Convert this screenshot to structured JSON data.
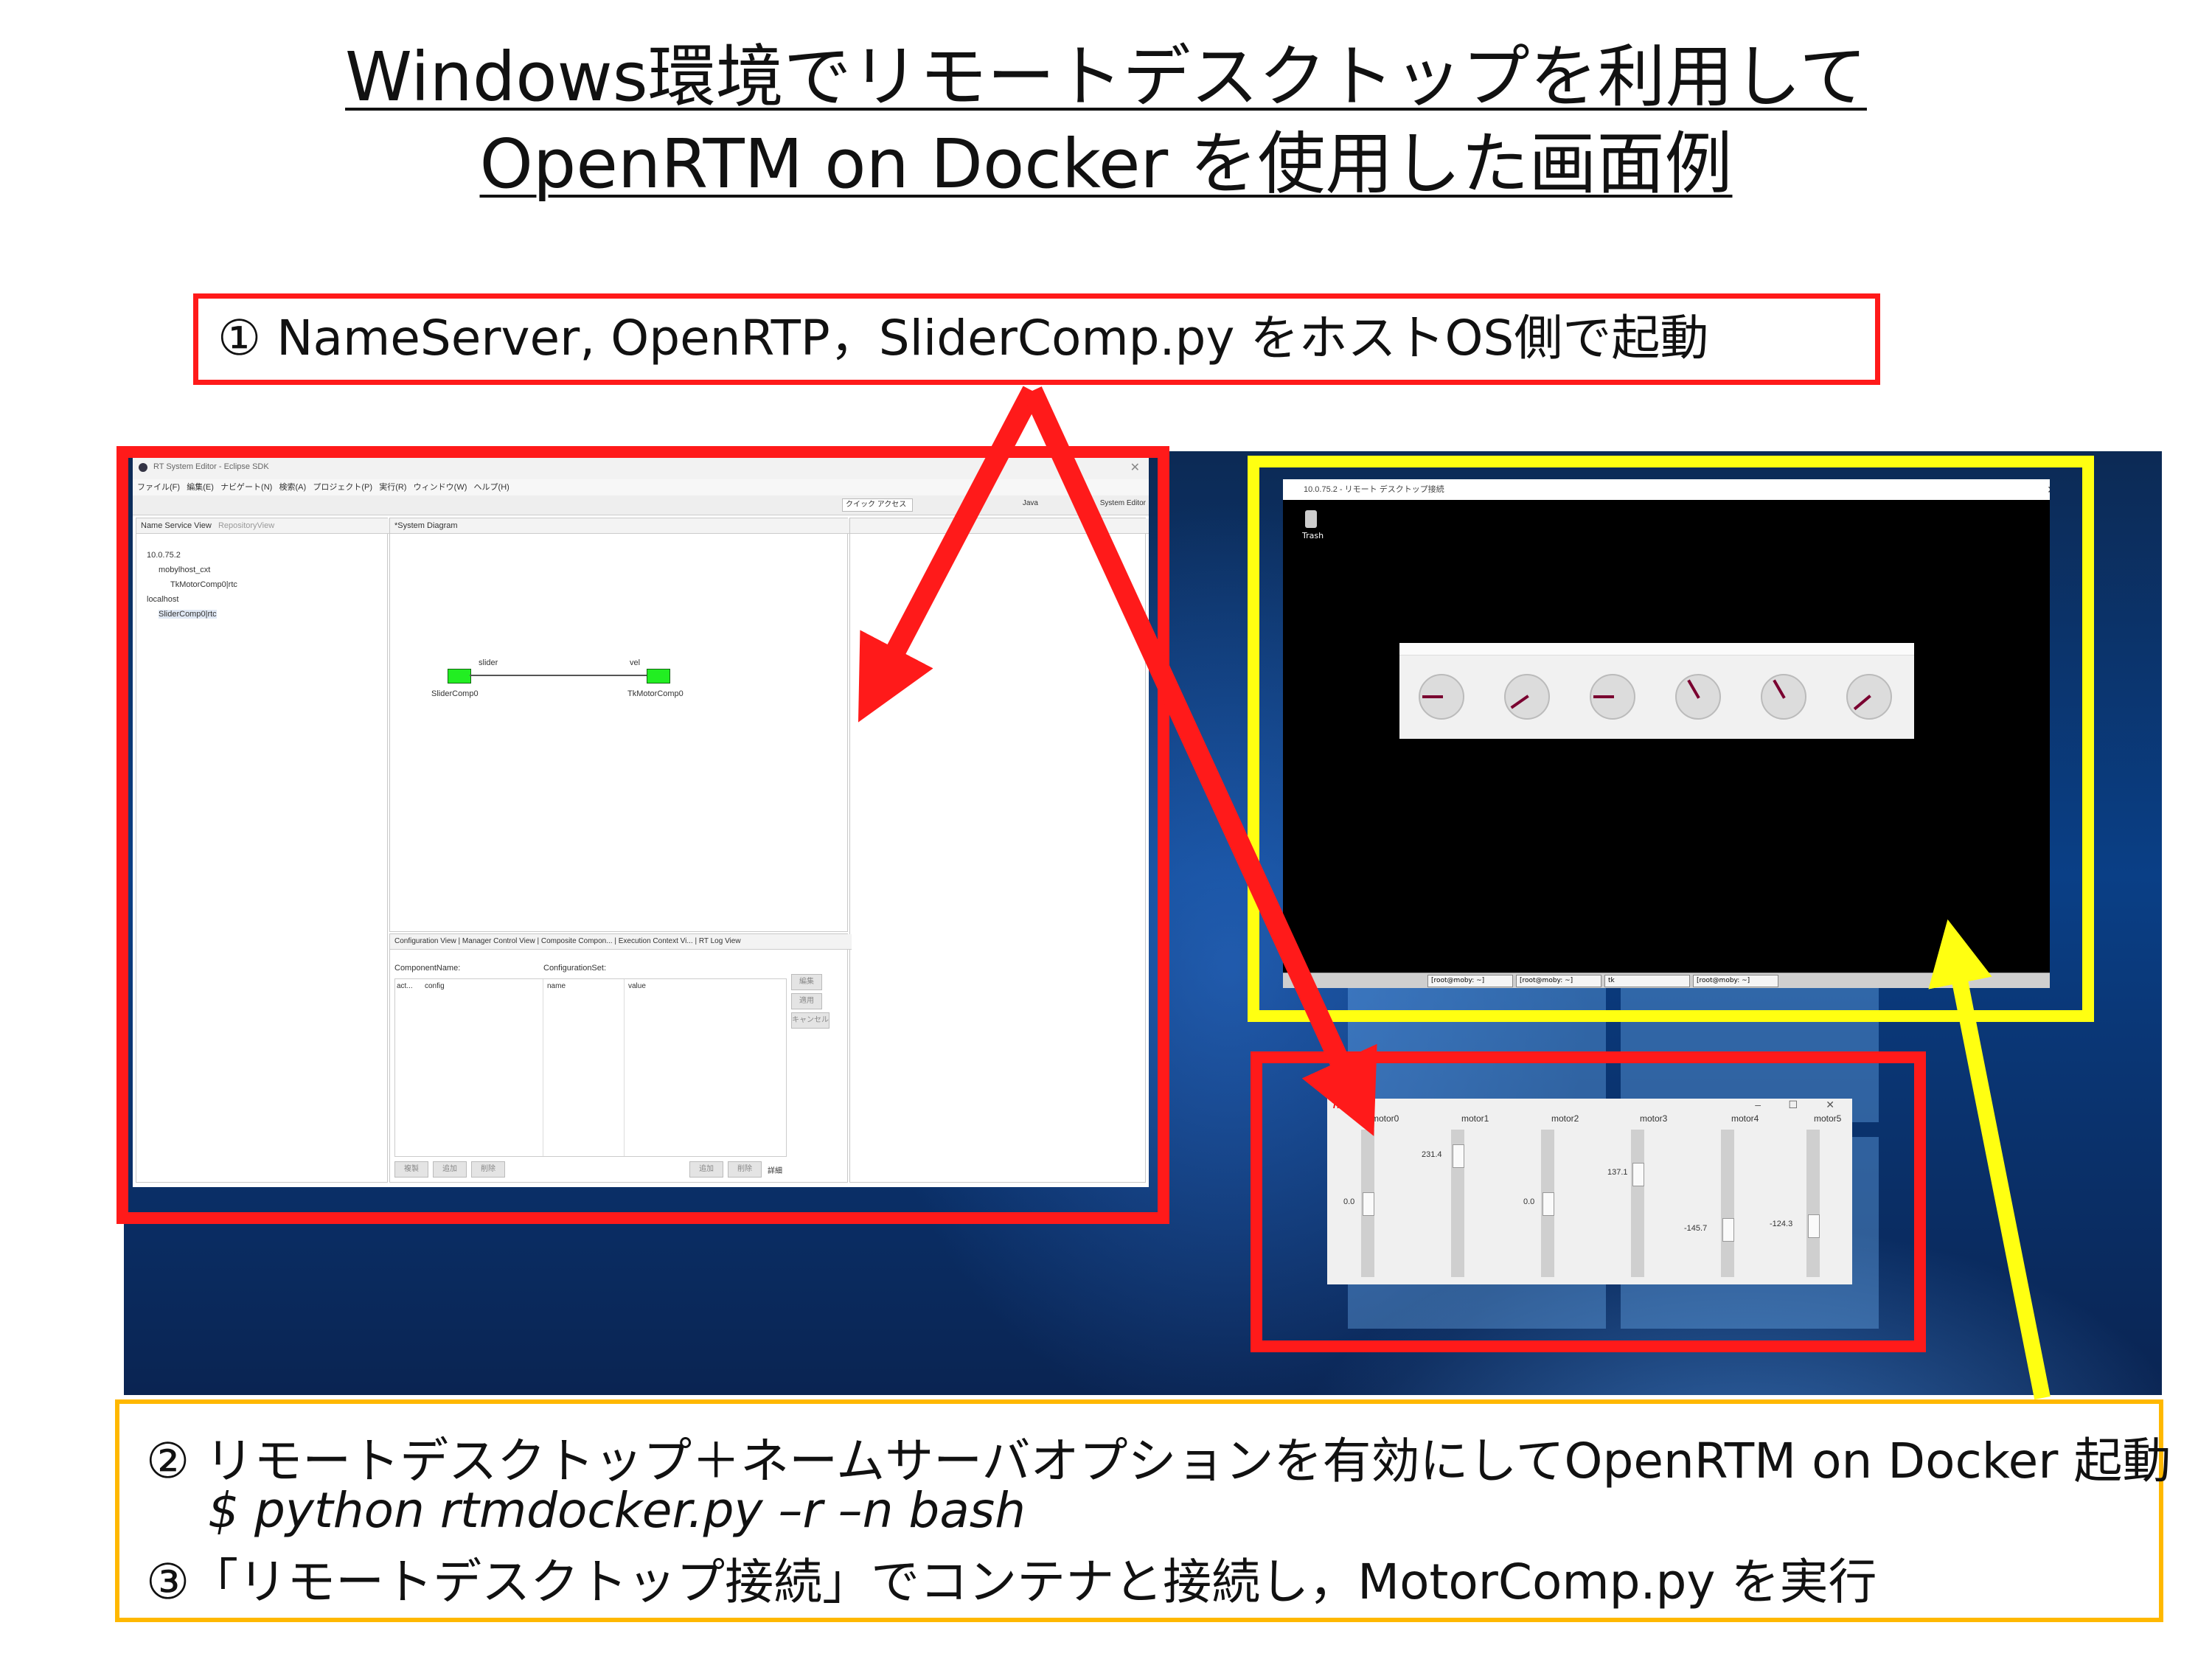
{
  "title": {
    "line1": "Windows環境でリモートデスクトップを利用して",
    "line2": "OpenRTM on Docker を使用した画面例"
  },
  "steps": {
    "step1": "① NameServer, OpenRTP，SliderComp.py をホストOS側で起動",
    "step2": "② リモートデスクトップ＋ネームサーバオプションを有効にしてOpenRTM on Docker 起動",
    "command": "$ python rtmdocker.py –r –n bash",
    "step3": "③「リモートデスクトップ接続」でコンテナと接続し，MotorComp.py を実行"
  },
  "eclipse": {
    "window_title": "RT System Editor - Eclipse SDK",
    "menu": [
      "ファイル(F)",
      "編集(E)",
      "ナビゲート(N)",
      "検索(A)",
      "プロジェクト(P)",
      "実行(R)",
      "ウィンドウ(W)",
      "ヘルプ(H)"
    ],
    "toolbar_right": [
      "クイック アクセス",
      "Java",
      "System Editor"
    ],
    "name_service_tab": "Name Service View",
    "repository_tab": "RepositoryView",
    "tree": [
      "10.0.75.2",
      "mobylhost_cxt",
      "TkMotorComp0|rtc",
      "localhost",
      "SliderComp0|rtc"
    ],
    "diagram_tab": "*System Diagram",
    "diagram": {
      "left_component": "SliderComp0",
      "right_component": "TkMotorComp0",
      "left_port": "slider",
      "right_port": "vel"
    },
    "bottom_tabs": [
      "Configuration View",
      "Manager Control View",
      "Composite Compon...",
      "Execution Context Vi...",
      "RT Log View"
    ],
    "config": {
      "component_name_label": "ComponentName:",
      "config_set_label": "ConfigurationSet:",
      "col_active": "act...",
      "col_config": "config",
      "col_name": "name",
      "col_value": "value",
      "side_buttons": [
        "編集",
        "適用",
        "キャンセル"
      ],
      "bottom_buttons_left": [
        "複製",
        "追加",
        "削除"
      ],
      "bottom_buttons_right": [
        "追加",
        "削除"
      ],
      "detail_label": "詳細"
    }
  },
  "rdp": {
    "window_title": "10.0.75.2 - リモート デスクトップ接続",
    "trash_label": "Trash",
    "dial_angles_deg": [
      0,
      -35,
      0,
      60,
      60,
      -40
    ],
    "taskbar_items": [
      "[root@moby: ~]",
      "[root@moby: ~]",
      "tk",
      "[root@moby: ~]"
    ]
  },
  "motor_window": {
    "title_badge": "Tk",
    "labels": [
      "motor0",
      "motor1",
      "motor2",
      "motor3",
      "motor4",
      "motor5"
    ],
    "values": [
      "0.0",
      "231.4",
      "0.0",
      "137.1",
      "-145.7",
      "-124.3"
    ]
  },
  "colors": {
    "red_frame": "#ff1a1a",
    "yellow_frame": "#ffff11",
    "orange_frame": "#ffb800",
    "port_green": "#22ee22",
    "needle": "#7a0030"
  }
}
